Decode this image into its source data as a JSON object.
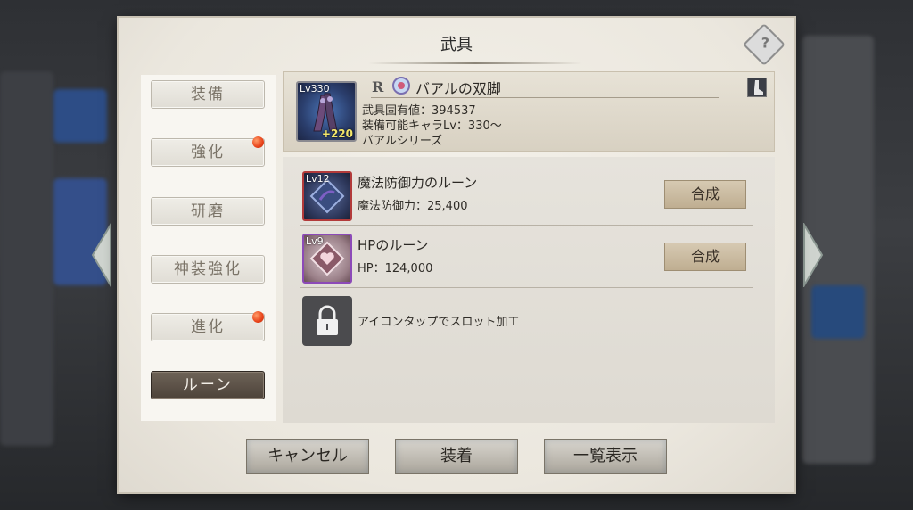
{
  "dialog": {
    "title": "武具",
    "help_glyph": "?"
  },
  "tabs": [
    {
      "label": "装備",
      "badge": false,
      "active": false
    },
    {
      "label": "強化",
      "badge": true,
      "active": false
    },
    {
      "label": "研磨",
      "badge": false,
      "active": false
    },
    {
      "label": "神装強化",
      "badge": false,
      "active": false
    },
    {
      "label": "進化",
      "badge": true,
      "active": false
    },
    {
      "label": "ルーン",
      "badge": false,
      "active": true
    }
  ],
  "weapon": {
    "level": "Lv330",
    "plus": "+220",
    "rarity": "R",
    "name": "バアルの双脚",
    "stats": [
      "武具固有値：394537",
      "装備可能キャラLv：330～",
      "バアルシリーズ"
    ],
    "element_icon": "element-orb-icon",
    "type_icon": "boot-icon"
  },
  "runes": [
    {
      "level": "Lv12",
      "name": "魔法防御力のルーン",
      "stat": "魔法防御力：25,400",
      "button": "合成",
      "border": "#b23a3a",
      "icon": "magic-defense-rune-icon"
    },
    {
      "level": "Lv9",
      "name": "HPのルーン",
      "stat": "HP：124,000",
      "button": "合成",
      "border": "#8c4ab8",
      "icon": "hp-rune-icon"
    }
  ],
  "locked_slot": {
    "text": "アイコンタップでスロット加工",
    "icon": "lock-icon"
  },
  "buttons": {
    "cancel": "キャンセル",
    "equip": "装着",
    "list": "一覧表示"
  }
}
